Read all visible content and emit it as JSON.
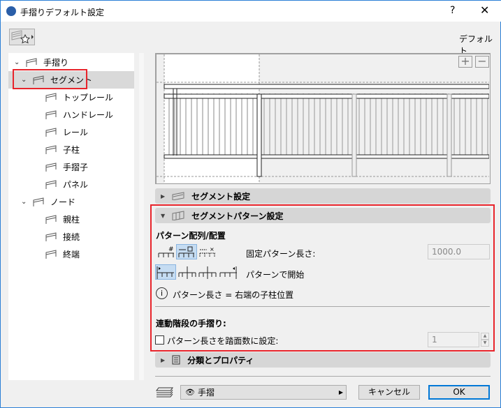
{
  "window": {
    "title": "手摺りデフォルト設定",
    "help": "?",
    "close": "✕"
  },
  "header": {
    "default_label": "デフォルト"
  },
  "tree": [
    {
      "label": "手摺り",
      "icon": "railing-icon"
    },
    {
      "label": "セグメント",
      "icon": "segment-icon"
    },
    {
      "label": "トップレール",
      "icon": "toprail-icon"
    },
    {
      "label": "ハンドレール",
      "icon": "handrail-icon"
    },
    {
      "label": "レール",
      "icon": "rail-icon"
    },
    {
      "label": "子柱",
      "icon": "post-icon"
    },
    {
      "label": "手摺子",
      "icon": "baluster-icon"
    },
    {
      "label": "パネル",
      "icon": "panel-icon"
    },
    {
      "label": "ノード",
      "icon": "node-icon"
    },
    {
      "label": "親柱",
      "icon": "main-post-icon"
    },
    {
      "label": "接続",
      "icon": "connection-icon"
    },
    {
      "label": "終端",
      "icon": "end-icon"
    }
  ],
  "preview": {
    "zoom_in": "+",
    "zoom_out": "−"
  },
  "sections": {
    "segment_settings": "セグメント設定",
    "pattern_settings": "セグメントパターン設定",
    "classification": "分類とプロパティ"
  },
  "pattern": {
    "arrangement_heading": "パターン配列/配置",
    "fixed_length_label": "固定パターン長さ:",
    "fixed_length_value": "1000.0",
    "start_label": "パターンで開始",
    "info_text": "パターン長さ = 右端の子柱位置",
    "stair_heading": "連動階段の手摺り:",
    "treads_checkbox_label": "パターン長さを踏面数に設定:",
    "treads_value": "1",
    "treads_checked": false
  },
  "footer": {
    "layer": "手摺",
    "cancel": "キャンセル",
    "ok": "OK"
  },
  "colors": {
    "accent": "#2b7fd6",
    "highlight": "#e8242b"
  }
}
